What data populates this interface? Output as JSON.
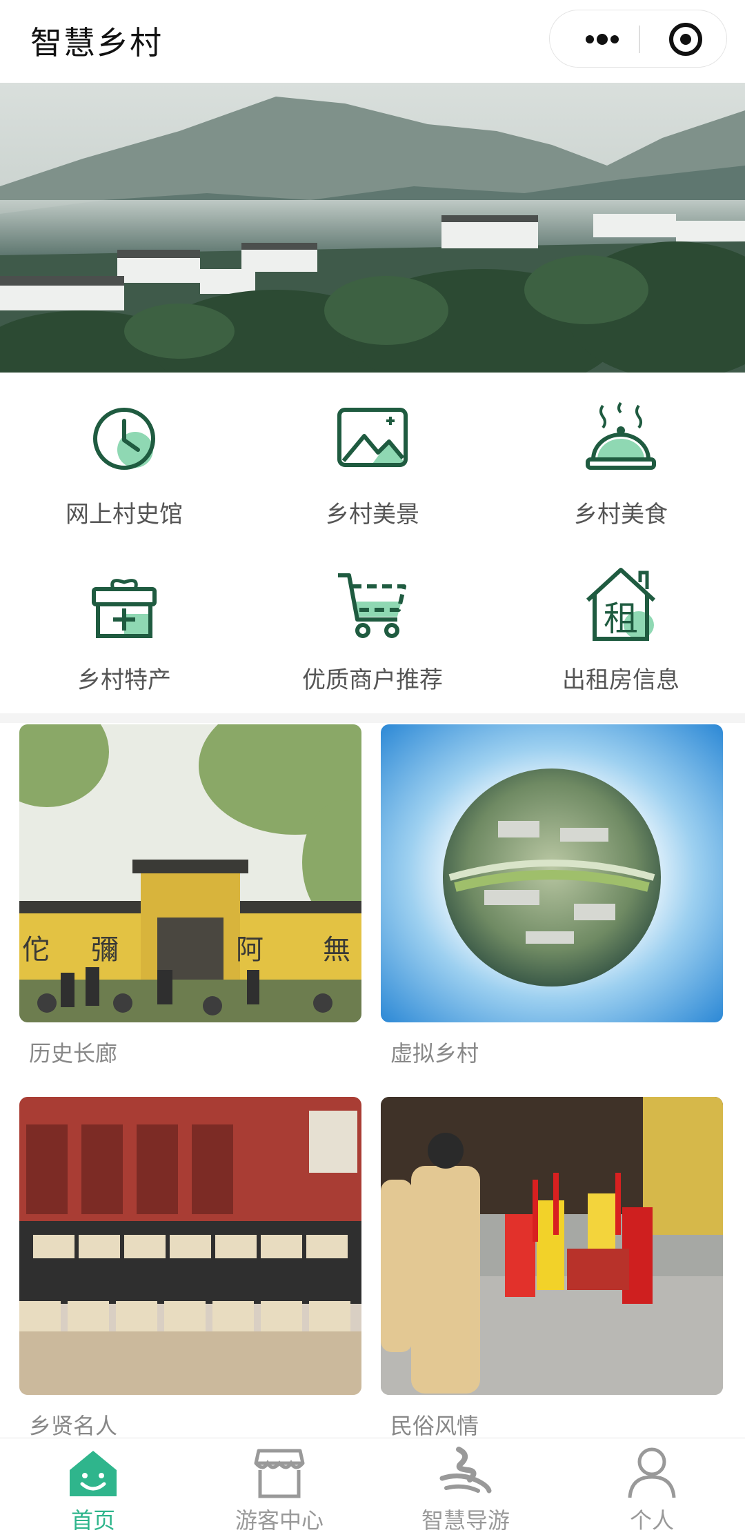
{
  "header": {
    "title": "智慧乡村",
    "more_icon": "more-dots-icon",
    "close_icon": "target-icon"
  },
  "banner": {
    "image": "misty-mountain-village-landscape",
    "slide_count": 1,
    "active_slide": 1
  },
  "menu": [
    {
      "label": "网上村史馆",
      "icon": "clock-icon"
    },
    {
      "label": "乡村美景",
      "icon": "picture-icon"
    },
    {
      "label": "乡村美食",
      "icon": "food-dome-icon"
    },
    {
      "label": "乡村特产",
      "icon": "gift-box-icon"
    },
    {
      "label": "优质商户推荐",
      "icon": "shopping-cart-icon"
    },
    {
      "label": "出租房信息",
      "icon": "rent-house-icon"
    }
  ],
  "cards": [
    {
      "caption": "历史长廊",
      "image": "yellow-temple-wall-old-photo"
    },
    {
      "caption": "虚拟乡村",
      "image": "panoramic-planet-village"
    },
    {
      "caption": "乡贤名人",
      "image": "group-photo-with-certificates"
    },
    {
      "caption": "民俗风情",
      "image": "folk-ceremony-gathering"
    }
  ],
  "tabbar": {
    "active": 0,
    "items": [
      {
        "label": "首页",
        "icon": "smiley-home-icon"
      },
      {
        "label": "游客中心",
        "icon": "store-icon"
      },
      {
        "label": "智慧导游",
        "icon": "guide-logo-icon"
      },
      {
        "label": "个人",
        "icon": "person-icon"
      }
    ]
  },
  "colors": {
    "accent": "#2fb58c",
    "icon_stroke": "#1f5b40",
    "icon_fill": "#8fd8b3",
    "tab_inactive": "#999999"
  }
}
